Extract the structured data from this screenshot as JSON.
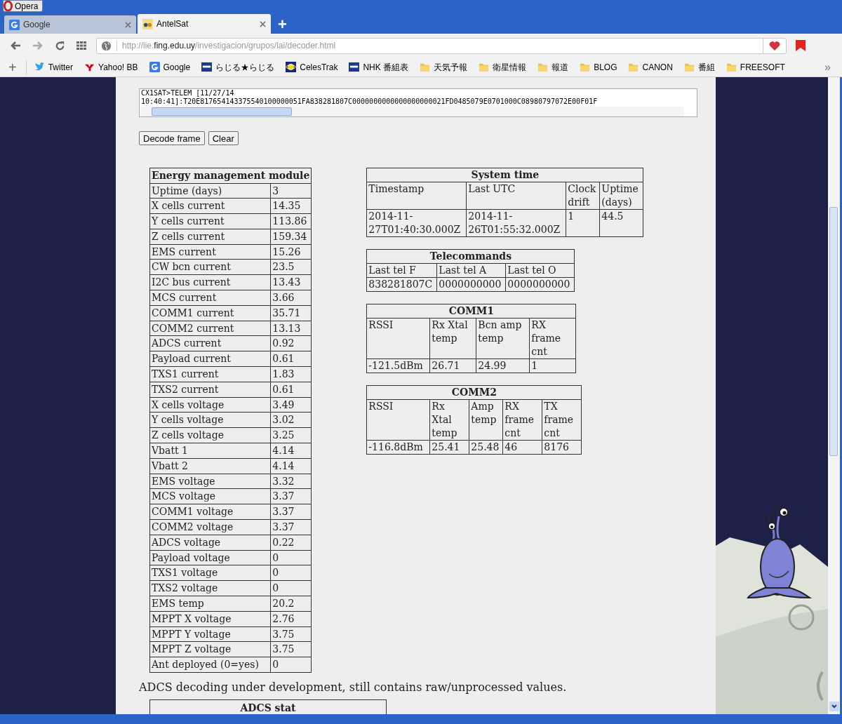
{
  "window": {
    "app_button": "Opera"
  },
  "tabs": [
    {
      "label": "Google",
      "selected": false,
      "kind": "google"
    },
    {
      "label": "AntelSat",
      "selected": true,
      "kind": "site"
    }
  ],
  "new_tab": "+",
  "address_bar": {
    "prefix": "http://iie.",
    "domain": "fing.edu.uy",
    "path": "/investigacion/grupos/lai/decoder.html"
  },
  "bookmarks_add": "+",
  "bookmarks": [
    {
      "label": "Twitter",
      "kind": "twitter"
    },
    {
      "label": "Yahoo! BB",
      "kind": "yahoo"
    },
    {
      "label": "Google",
      "kind": "google"
    },
    {
      "label": "らじる★らじる",
      "kind": "nhk"
    },
    {
      "label": "CelesTrak",
      "kind": "celestrak"
    },
    {
      "label": "NHK 番組表",
      "kind": "nhk"
    },
    {
      "label": "天気予報",
      "kind": "folder"
    },
    {
      "label": "衛星情報",
      "kind": "folder"
    },
    {
      "label": "報道",
      "kind": "folder"
    },
    {
      "label": "BLOG",
      "kind": "folder"
    },
    {
      "label": "CANON",
      "kind": "folder"
    },
    {
      "label": "番組",
      "kind": "folder"
    },
    {
      "label": "FREESOFT",
      "kind": "folder"
    }
  ],
  "bookmarks_more": "»",
  "frame_input": {
    "lines": [
      "CX1SAT>TELEM [11/27/14",
      "10:40:41]:T20E817654143375540100000051FA838281807C0000000000000000000021FD0485079E0701000C08980797072E00F01F"
    ]
  },
  "buttons": [
    "Decode frame",
    "Clear"
  ],
  "energy_table": {
    "title": "Energy management module",
    "rows": [
      [
        "Uptime (days)",
        "3"
      ],
      [
        "X cells current",
        "14.35"
      ],
      [
        "Y cells current",
        "113.86"
      ],
      [
        "Z cells current",
        "159.34"
      ],
      [
        "EMS current",
        "15.26"
      ],
      [
        "CW bcn current",
        "23.5"
      ],
      [
        "I2C bus current",
        "13.43"
      ],
      [
        "MCS current",
        "3.66"
      ],
      [
        "COMM1 current",
        "35.71"
      ],
      [
        "COMM2 current",
        "13.13"
      ],
      [
        "ADCS current",
        "0.92"
      ],
      [
        "Payload current",
        "0.61"
      ],
      [
        "TXS1 current",
        "1.83"
      ],
      [
        "TXS2 current",
        "0.61"
      ],
      [
        "X cells voltage",
        "3.49"
      ],
      [
        "Y cells voltage",
        "3.02"
      ],
      [
        "Z cells voltage",
        "3.25"
      ],
      [
        "Vbatt 1",
        "4.14"
      ],
      [
        "Vbatt 2",
        "4.14"
      ],
      [
        "EMS voltage",
        "3.32"
      ],
      [
        "MCS voltage",
        "3.37"
      ],
      [
        "COMM1 voltage",
        "3.37"
      ],
      [
        "COMM2 voltage",
        "3.37"
      ],
      [
        "ADCS voltage",
        "0.22"
      ],
      [
        "Payload voltage",
        "0"
      ],
      [
        "TXS1 voltage",
        "0"
      ],
      [
        "TXS2 voltage",
        "0"
      ],
      [
        "EMS temp",
        "20.2"
      ],
      [
        "MPPT X voltage",
        "2.76"
      ],
      [
        "MPPT Y voltage",
        "3.75"
      ],
      [
        "MPPT Z voltage",
        "3.75"
      ],
      [
        "Ant deployed (0=yes)",
        "0"
      ]
    ]
  },
  "side_tables": [
    {
      "title": "System time",
      "columns": [
        "Timestamp",
        "Last UTC",
        "Clock drift",
        "Uptime (days)"
      ],
      "rows": [
        [
          "2014-11-27T01:40:30.000Z",
          "2014-11-26T01:55:32.000Z",
          "1",
          "44.5"
        ]
      ]
    },
    {
      "title": "Telecommands",
      "columns": [
        "Last tel F",
        "Last tel A",
        "Last tel O"
      ],
      "rows": [
        [
          "838281807C",
          "0000000000",
          "0000000000"
        ]
      ]
    },
    {
      "title": "COMM1",
      "columns": [
        "RSSI",
        "Rx Xtal temp",
        "Bcn amp temp",
        "RX frame cnt"
      ],
      "rows": [
        [
          "-121.5dBm",
          "26.71",
          "24.99",
          "1"
        ]
      ]
    },
    {
      "title": "COMM2",
      "columns": [
        "RSSI",
        "Rx Xtal temp",
        "Amp temp",
        "RX frame cnt",
        "TX frame cnt"
      ],
      "rows": [
        [
          "-116.8dBm",
          "25.41",
          "25.48",
          "46",
          "8176"
        ]
      ]
    }
  ],
  "note": "ADCS decoding under development, still contains raw/unprocessed values.",
  "adcs_table": {
    "title": "ADCS stat"
  }
}
